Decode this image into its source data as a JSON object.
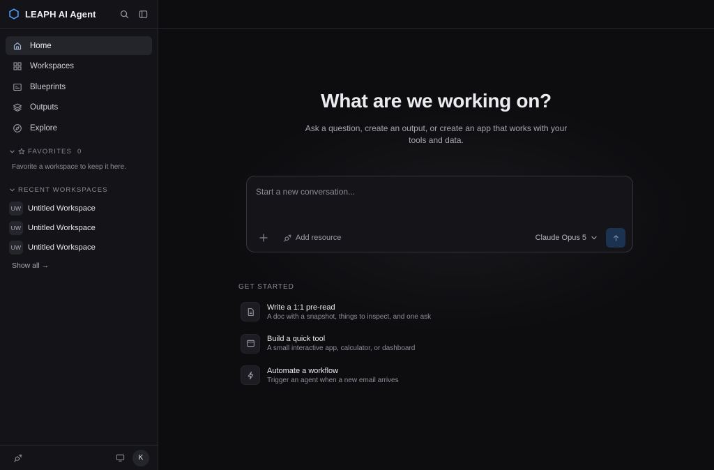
{
  "app": {
    "title": "LEAPH AI Agent"
  },
  "sidebar": {
    "nav": [
      {
        "label": "Home",
        "icon": "home-icon",
        "active": true
      },
      {
        "label": "Workspaces",
        "icon": "grid-icon"
      },
      {
        "label": "Blueprints",
        "icon": "blueprint-icon"
      },
      {
        "label": "Outputs",
        "icon": "layers-icon"
      },
      {
        "label": "Explore",
        "icon": "compass-icon"
      }
    ],
    "favorites": {
      "title": "FAVORITES",
      "count": "0",
      "empty_hint": "Favorite a workspace to keep it here."
    },
    "recent": {
      "title": "RECENT WORKSPACES",
      "items": [
        {
          "badge": "UW",
          "name": "Untitled Workspace"
        },
        {
          "badge": "UW",
          "name": "Untitled Workspace"
        },
        {
          "badge": "UW",
          "name": "Untitled Workspace"
        }
      ],
      "show_all": "Show all →"
    },
    "footer": {
      "avatar": "K"
    }
  },
  "main": {
    "title": "What are we working on?",
    "subtitle": "Ask a question, create an output, or create an app that works with your tools and data.",
    "composer": {
      "placeholder": "Start a new conversation...",
      "add_resource": "Add resource",
      "model": "Claude Opus 5"
    },
    "get_started": {
      "title": "GET STARTED",
      "items": [
        {
          "title": "Write a 1:1 pre-read",
          "desc": "A doc with a snapshot, things to inspect, and one ask",
          "icon": "document-icon"
        },
        {
          "title": "Build a quick tool",
          "desc": "A small interactive app, calculator, or dashboard",
          "icon": "window-icon"
        },
        {
          "title": "Automate a workflow",
          "desc": "Trigger an agent when a new email arrives",
          "icon": "lightning-icon"
        }
      ]
    }
  },
  "colors": {
    "accent": "#1b3350",
    "logo": "#4a9eff",
    "background": "#0d0d10",
    "sidebar": "#141418"
  }
}
